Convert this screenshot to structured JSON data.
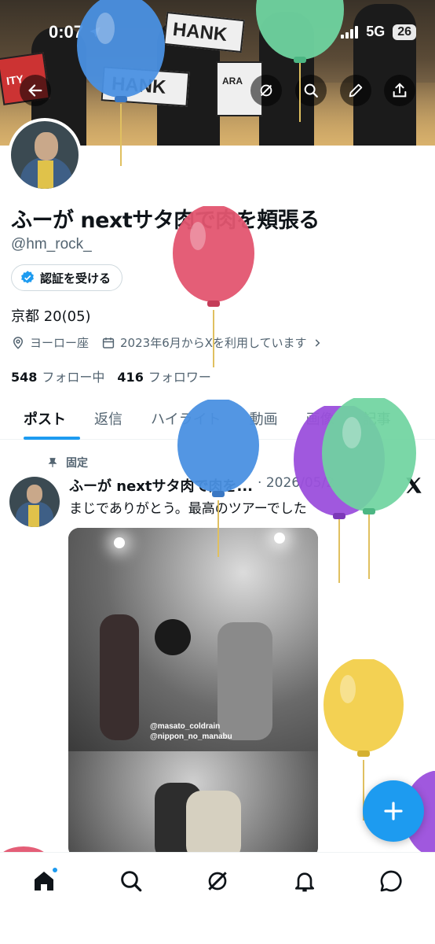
{
  "status_bar": {
    "time": "0:07",
    "network": "5G",
    "battery": "26"
  },
  "banner": {
    "flag_texts": [
      "HANK",
      "HANK",
      "ARA",
      "ITY"
    ]
  },
  "profile": {
    "name": "ふーが nextサタ肉で肉を頬張る",
    "handle": "@hm_rock_",
    "verify_label": "認証を受ける",
    "bio": "京都 20(05)",
    "location": "ヨーロー座",
    "joined": "2023年6月からXを利用しています",
    "following_count": "548",
    "following_label": "フォロー中",
    "followers_count": "416",
    "followers_label": "フォロワー"
  },
  "tabs": [
    "ポスト",
    "返信",
    "ハイライト",
    "動画",
    "画像",
    "記事"
  ],
  "pinned_post": {
    "pinned_label": "固定",
    "author": "ふーが nextサタ肉で肉を...",
    "date": "· 2026/05/2",
    "text": "まじでありがとう。最高のツアーでした",
    "credit_line1": "@masato_coldrain",
    "credit_line2": "@nippon_no_manabu"
  },
  "colors": {
    "accent": "#1d9bf0",
    "text": "#0f1419",
    "muted": "#536471"
  },
  "icons": [
    "back-arrow-icon",
    "grok-icon",
    "search-icon",
    "edit-icon",
    "share-icon",
    "verified-badge-icon",
    "location-icon",
    "calendar-icon",
    "pin-icon",
    "x-logo-icon",
    "plus-icon",
    "home-icon",
    "explore-icon",
    "grok-nav-icon",
    "bell-icon",
    "messages-icon"
  ]
}
